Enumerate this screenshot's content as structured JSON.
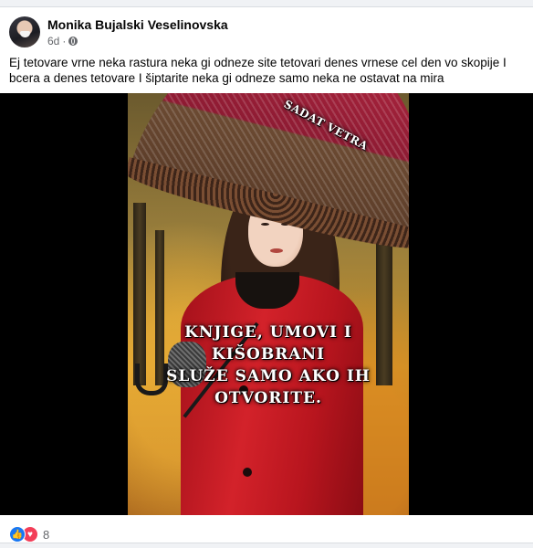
{
  "post": {
    "author": "Monika Bujalski Veselinovska",
    "timestamp": "6d",
    "separator": "·",
    "audience_icon": "globe-icon",
    "text": "Ej tetovare vrne neka rastura neka gi odneze site tetovari denes vrnese cel den vo skopije I bcera a denes tetovare I šiptarite neka gi odneze samo neka ne ostavat na mira"
  },
  "image": {
    "watermark": "SADAT VETRA",
    "quote_lines": [
      "KNJIGE, UMOVI I KIŠOBRANI",
      "SLUŽE SAMO AKO IH",
      "OTVORITE."
    ]
  },
  "reactions": {
    "icons": [
      "like-icon",
      "love-icon"
    ],
    "count": "8",
    "like_color": "#1877f2",
    "love_color": "#f33e58"
  }
}
